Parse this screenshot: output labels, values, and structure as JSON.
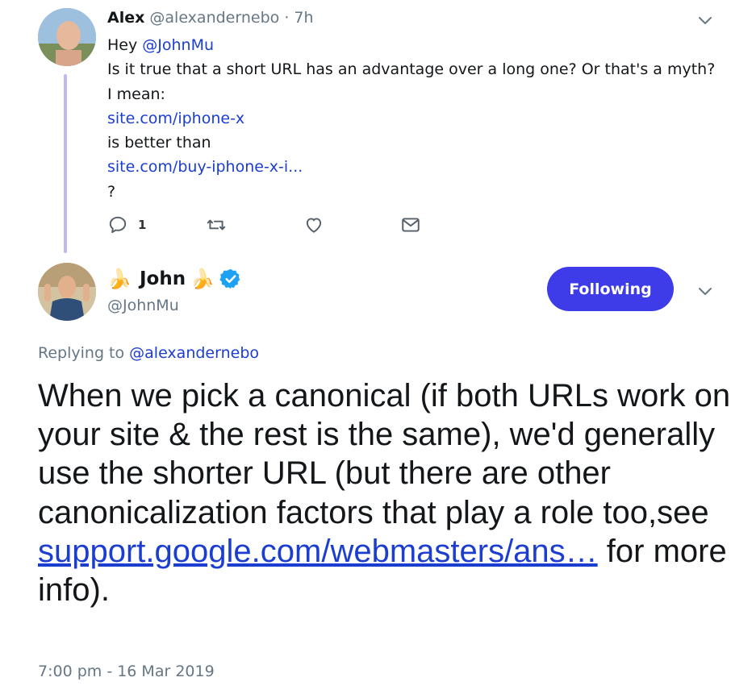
{
  "parent_tweet": {
    "name": "Alex",
    "handle": "@alexandernebo",
    "time": "· 7h",
    "lines": {
      "greeting": "Hey ",
      "mention": "@JohnMu",
      "question": "Is it true that a short URL has an advantage over a long one? Or that's a myth?",
      "mean": "I mean:",
      "url_short": "site.com/iphone-x",
      "better": "is better than",
      "url_long": "site.com/buy-iphone-x-i...",
      "qmark": "?"
    },
    "reply_count": "1"
  },
  "reply_tweet": {
    "banana_left": "🍌",
    "name": "John",
    "banana_right": "🍌",
    "handle": "@JohnMu",
    "follow_label": "Following",
    "replying_prefix": "Replying to ",
    "replying_handle": "@alexandernebo",
    "text_before": "When we pick a canonical (if both URLs work on your site & the rest is the same), we'd generally use the shorter URL (but there are other canonicalization factors that play a role too,see ",
    "link_text": "support.google.com/webmasters/ans…",
    "text_after": " for more info).",
    "timestamp": "7:00 pm - 16 Mar 2019"
  },
  "colors": {
    "accent": "#3d3ce8",
    "link": "#1b3ed1",
    "thread_line": "#c4b7ef",
    "verified": "#1da1f2",
    "muted": "#657786"
  },
  "icons": [
    "chevron-down-icon",
    "reply-icon",
    "retweet-icon",
    "like-icon",
    "direct-message-icon",
    "verified-icon"
  ]
}
